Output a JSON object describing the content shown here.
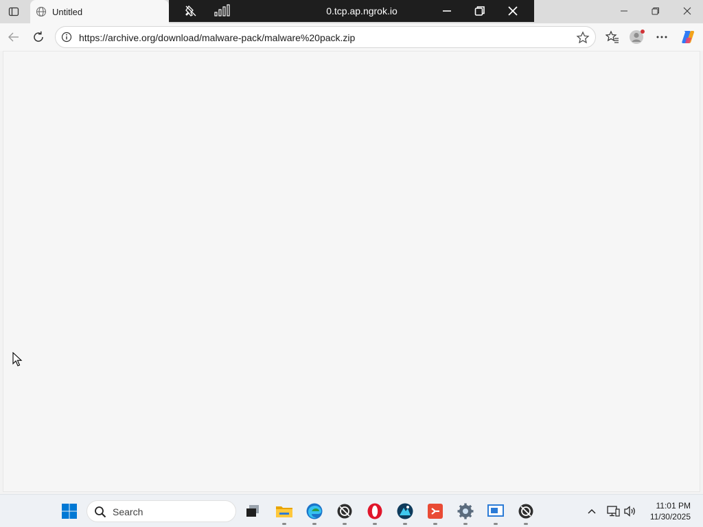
{
  "browser": {
    "tab": {
      "title": "Untitled"
    },
    "remote_bar": {
      "title": "0.tcp.ap.ngrok.io"
    },
    "address": {
      "url": "https://archive.org/download/malware-pack/malware%20pack.zip"
    }
  },
  "taskbar": {
    "search_placeholder": "Search",
    "clock": {
      "time": "11:01 PM",
      "date": "11/30/2025"
    }
  },
  "colors": {
    "remote_bar_bg": "#1e1e1e",
    "opera_red": "#e0162b",
    "edge_blue": "#1b74c9",
    "windows_blue": "#0078d4"
  },
  "icons": [
    "tab-actions-icon",
    "globe-icon",
    "pin-off-icon",
    "signal-icon",
    "minimize-icon",
    "restore-icon",
    "close-icon",
    "back-arrow-icon",
    "refresh-icon",
    "info-icon",
    "star-icon",
    "favorites-icon",
    "profile-icon",
    "more-icon",
    "copilot-icon",
    "windows-start-icon",
    "search-icon",
    "task-view-icon",
    "file-explorer-icon",
    "edge-icon",
    "app-icon",
    "opera-icon",
    "app-icon",
    "git-icon",
    "settings-icon",
    "remote-desktop-icon",
    "chevron-up-icon",
    "network-icon",
    "speaker-icon"
  ]
}
